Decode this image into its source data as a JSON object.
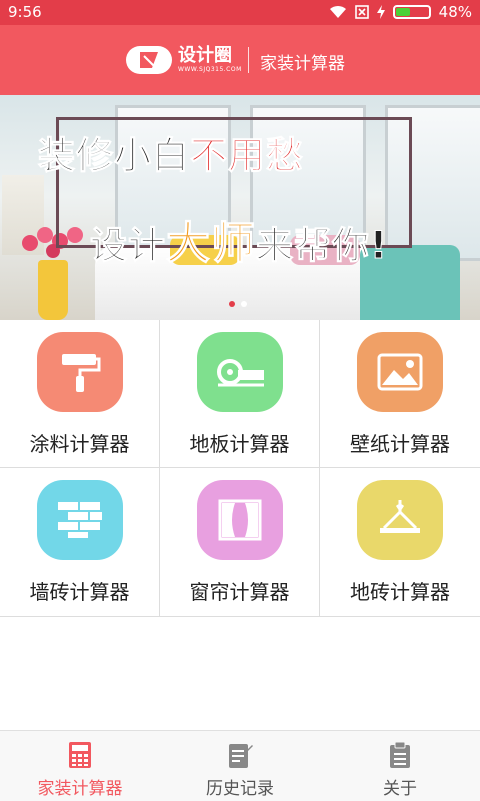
{
  "status_bar": {
    "time": "9:56",
    "battery": "48%",
    "battery_level": 0.48
  },
  "header": {
    "logo_text": "设计圈",
    "logo_sub": "WWW.SJQ315.COM",
    "title": "家装计算器"
  },
  "banner": {
    "line1_a": "装修小白",
    "line1_b": "不用愁",
    "line2_a": "设计",
    "line2_b": "大师",
    "line2_c": "来帮你!"
  },
  "calculators": [
    {
      "label": "涂料计算器",
      "icon": "paint-roller-icon",
      "color": "#f58a74"
    },
    {
      "label": "地板计算器",
      "icon": "tape-measure-icon",
      "color": "#7fe08e"
    },
    {
      "label": "壁纸计算器",
      "icon": "picture-icon",
      "color": "#f0a066"
    },
    {
      "label": "墙砖计算器",
      "icon": "brick-wall-icon",
      "color": "#72d7e8"
    },
    {
      "label": "窗帘计算器",
      "icon": "curtain-icon",
      "color": "#e8a0e0"
    },
    {
      "label": "地砖计算器",
      "icon": "crane-hook-icon",
      "color": "#e9d86a"
    }
  ],
  "bottom_nav": [
    {
      "label": "家装计算器",
      "icon": "calculator-icon",
      "active": true
    },
    {
      "label": "历史记录",
      "icon": "history-notepad-icon",
      "active": false
    },
    {
      "label": "关于",
      "icon": "clipboard-icon",
      "active": false
    }
  ],
  "colors": {
    "accent": "#f2585f",
    "status_bar": "#e33d49"
  }
}
